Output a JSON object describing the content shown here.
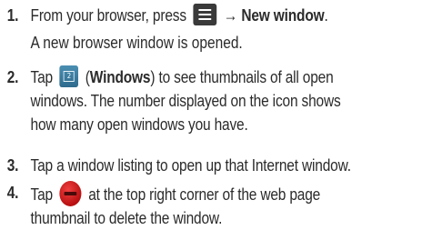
{
  "steps": [
    {
      "number": "1.",
      "before_icon": "From your browser, press",
      "icon": "menu-icon",
      "arrow": "→",
      "bold": "New window",
      "after": ".",
      "sub": "A new browser window is opened."
    },
    {
      "number": "2.",
      "before_icon": "Tap",
      "icon": "windows-icon",
      "icon_badge": "2",
      "paren_open": "(",
      "bold": "Windows",
      "paren_close": ")",
      "line1_rest": " to see thumbnails of all open",
      "line2": "windows. The number displayed on the icon shows",
      "line3": "how many open windows you have."
    },
    {
      "number": "3.",
      "text": "Tap a window listing to open up that Internet window."
    },
    {
      "number": "4.",
      "before_icon": "Tap",
      "icon": "close-window-icon",
      "line1_rest": "at the top right corner of the web page",
      "line2": "thumbnail to delete the window."
    }
  ]
}
